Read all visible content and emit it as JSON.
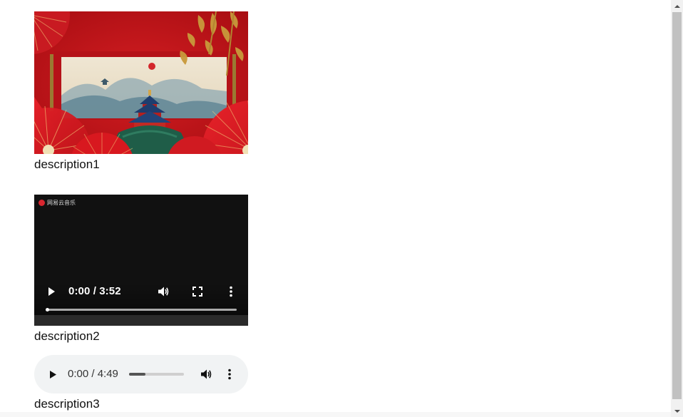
{
  "media_items": [
    {
      "type": "image",
      "description": "description1"
    },
    {
      "type": "video",
      "description": "description2",
      "time_display": "0:00 / 3:52",
      "progress": 0,
      "watermark": "网易云音乐"
    },
    {
      "type": "audio",
      "description": "description3",
      "time_display": "0:00 / 4:49",
      "volume_level": 0.3
    }
  ],
  "colors": {
    "video_bg": "#111111",
    "audio_bg": "#f1f3f4",
    "image_red": "#c8141c",
    "scrollbar_thumb": "#c1c1c1"
  },
  "icons": {
    "video": [
      "play-icon",
      "volume-icon",
      "fullscreen-icon",
      "more-options-icon"
    ],
    "audio": [
      "play-icon",
      "volume-icon",
      "more-options-icon"
    ],
    "scrollbar": [
      "arrow-up-icon",
      "arrow-down-icon"
    ]
  }
}
